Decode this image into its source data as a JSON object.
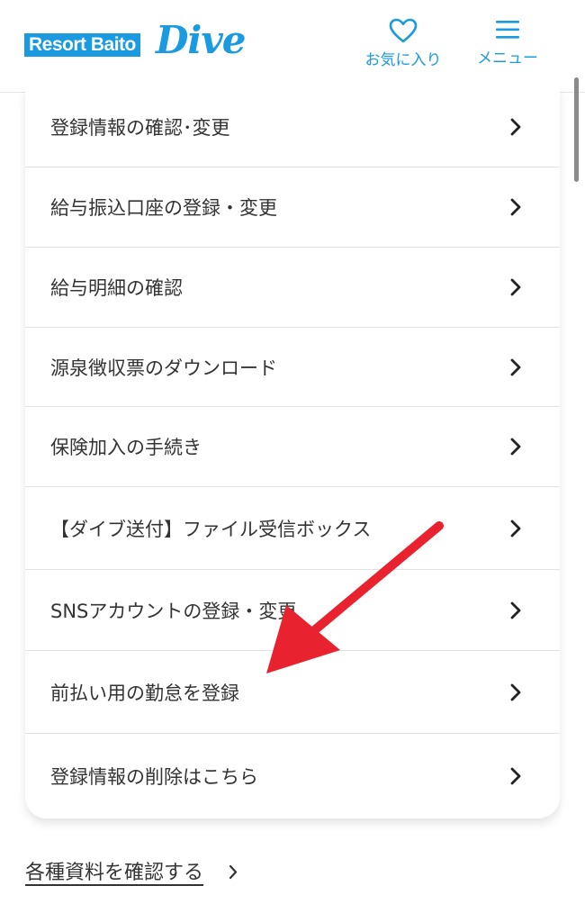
{
  "header": {
    "logo_text": "Resort Baito",
    "logo_script": "Dive",
    "favorites_label": "お気に入り",
    "menu_label": "メニュー",
    "favorites_icon": "heart-icon",
    "menu_icon": "hamburger-icon"
  },
  "menu": {
    "items": [
      {
        "label": "登録情報の確認･変更"
      },
      {
        "label": "給与振込口座の登録・変更"
      },
      {
        "label": "給与明細の確認"
      },
      {
        "label": "源泉徴収票のダウンロード"
      },
      {
        "label": "保険加入の手続き"
      },
      {
        "label": "【ダイブ送付】ファイル受信ボックス"
      },
      {
        "label": "SNSアカウントの登録・変更"
      },
      {
        "label": "前払い用の勤怠を登録"
      },
      {
        "label": "登録情報の削除はこちら"
      }
    ]
  },
  "footer": {
    "docs_link": "各種資料を確認する"
  },
  "colors": {
    "brand": "#1a9be0",
    "annotation_arrow": "#e8222e",
    "text": "#333333",
    "divider": "#e2e2e2"
  }
}
